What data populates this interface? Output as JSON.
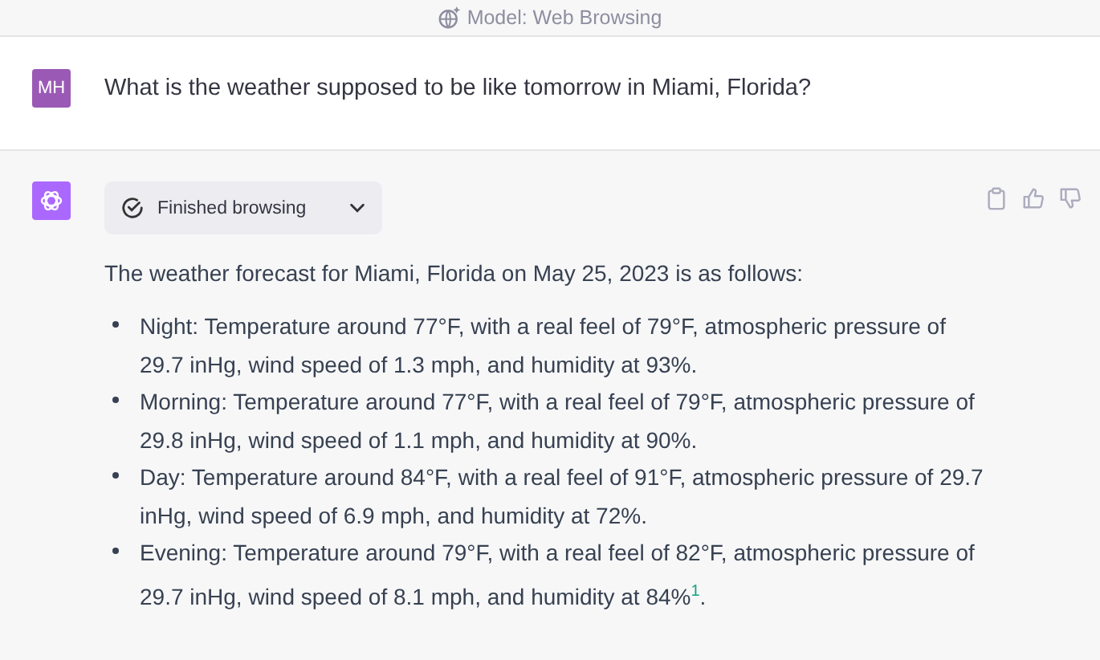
{
  "header": {
    "model_label": "Model: Web Browsing"
  },
  "user_message": {
    "avatar_initials": "MH",
    "text": "What is the weather supposed to be like tomorrow in Miami, Florida?"
  },
  "assistant_message": {
    "browsing_status": {
      "label": "Finished browsing",
      "expanded": false
    },
    "intro": "The weather forecast for Miami, Florida on May 25, 2023 is as follows:",
    "items": [
      {
        "text": "Night: Temperature around 77°F, with a real feel of 79°F, atmospheric pressure of 29.7 inHg, wind speed of 1.3 mph, and humidity at 93%."
      },
      {
        "text": "Morning: Temperature around 77°F, with a real feel of 79°F, atmospheric pressure of 29.8 inHg, wind speed of 1.1 mph, and humidity at 90%."
      },
      {
        "text": "Day: Temperature around 84°F, with a real feel of 91°F, atmospheric pressure of 29.7 inHg, wind speed of 6.9 mph, and humidity at 72%."
      },
      {
        "text": "Evening: Temperature around 79°F, with a real feel of 82°F, atmospheric pressure of 29.7 inHg, wind speed of 8.1 mph, and humidity at 84%$^{1}$."
      }
    ]
  }
}
